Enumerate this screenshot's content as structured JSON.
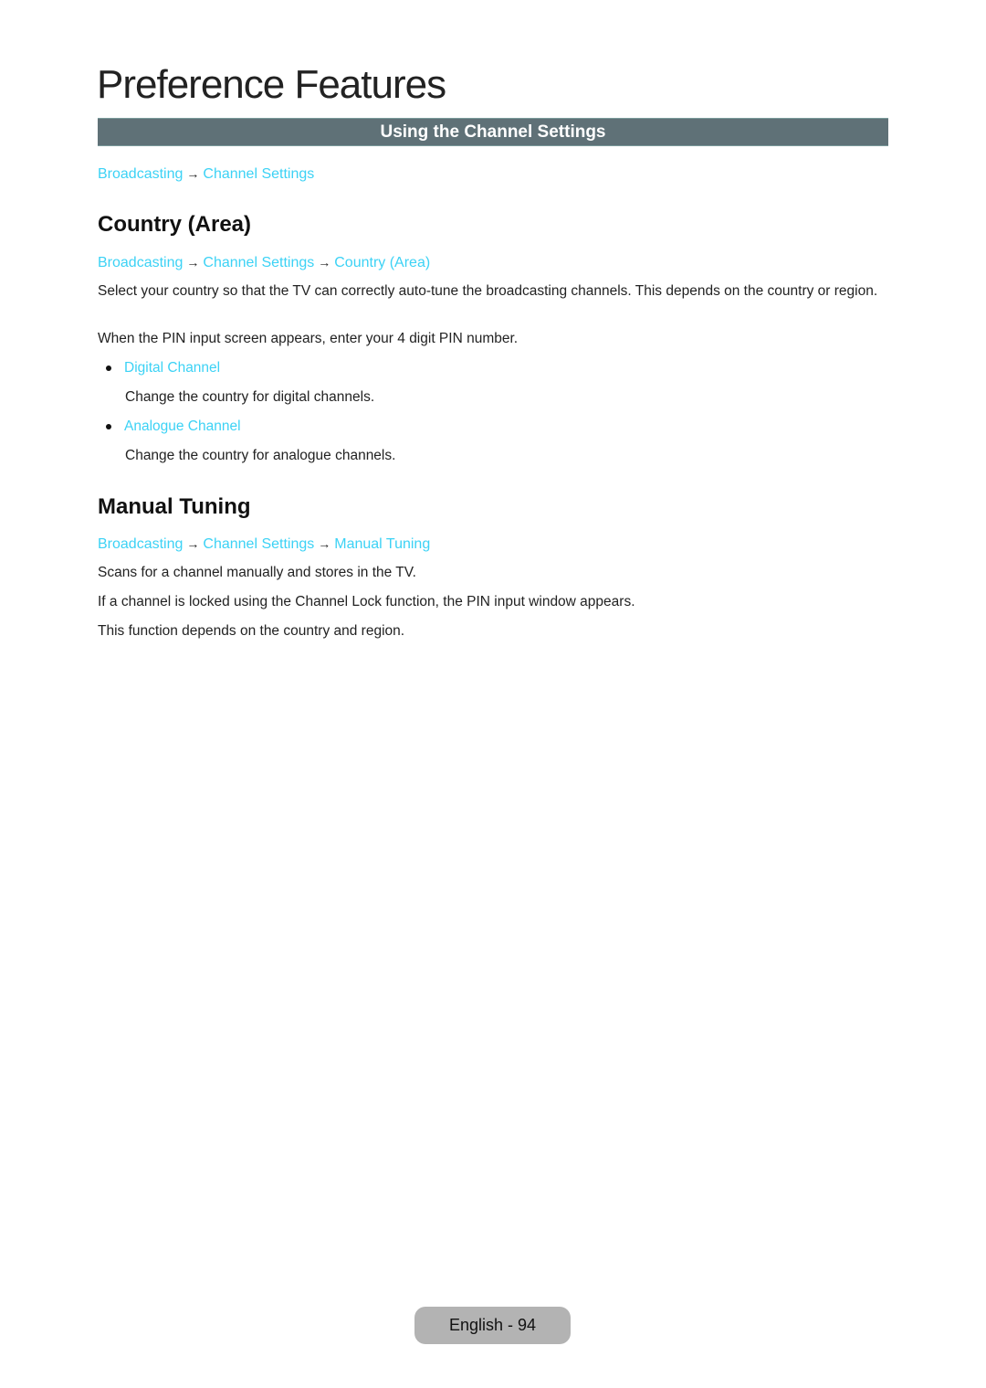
{
  "page": {
    "title": "Preference Features",
    "section_bar": "Using the Channel Settings",
    "section_path": [
      "Broadcasting",
      "Channel Settings"
    ],
    "footer": "English - 94"
  },
  "country_area": {
    "heading": "Country (Area)",
    "path": [
      "Broadcasting",
      "Channel Settings",
      "Country (Area)"
    ],
    "paragraphs": [
      "Select your country so that the TV can correctly auto-tune the broadcasting channels. This depends on the country or region.",
      "When the PIN input screen appears, enter your 4 digit PIN number."
    ],
    "items": [
      {
        "label": "Digital Channel",
        "description": "Change the country for digital channels."
      },
      {
        "label": "Analogue Channel",
        "description": "Change the country for analogue channels."
      }
    ]
  },
  "manual_tuning": {
    "heading": "Manual Tuning",
    "path": [
      "Broadcasting",
      "Channel Settings",
      "Manual Tuning"
    ],
    "paragraphs": [
      "Scans for a channel manually and stores in the TV.",
      "If a channel is locked using the Channel Lock function, the PIN input window appears.",
      "This function depends on the country and region."
    ]
  },
  "glyphs": {
    "arrow": "→"
  },
  "colors": {
    "link": "#3cd2f5",
    "section_bar": "#5f7177",
    "footer_pill": "#b3b3b3"
  }
}
